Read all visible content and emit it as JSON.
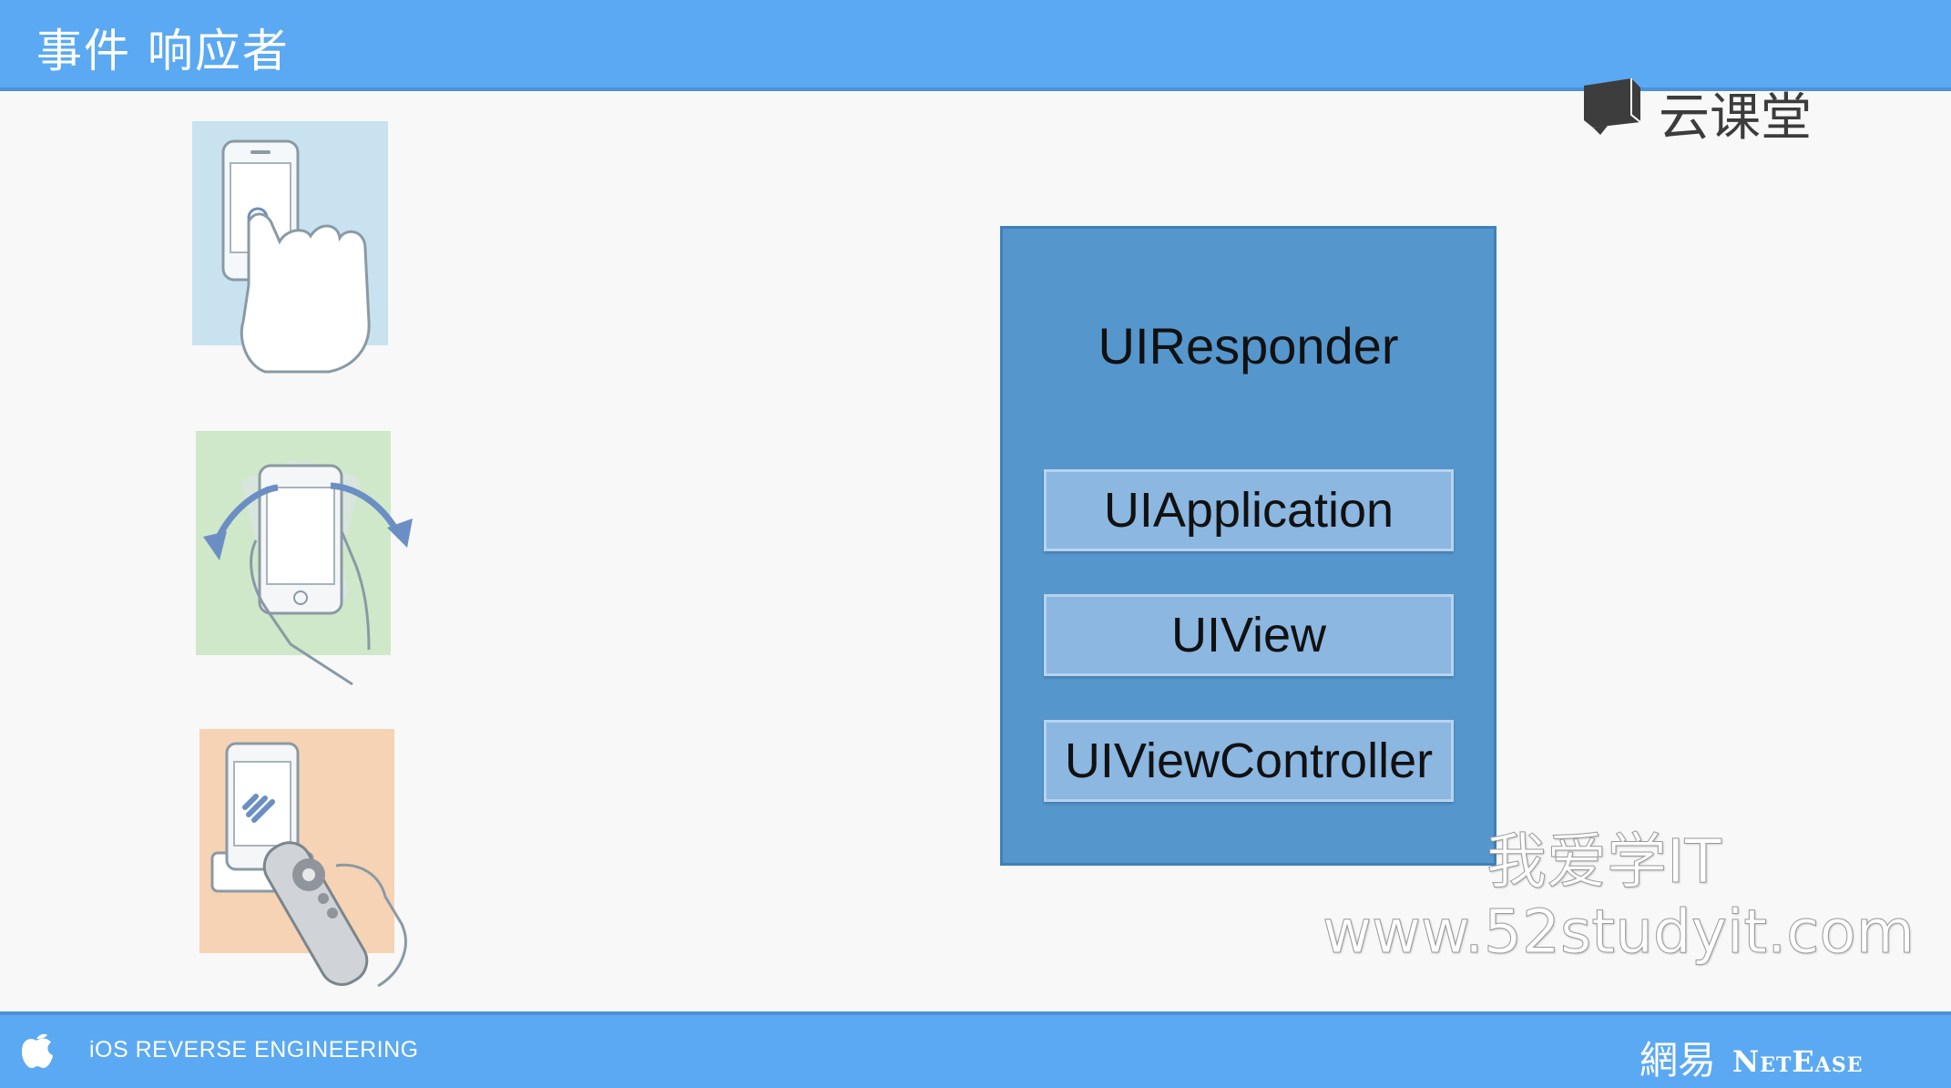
{
  "header": {
    "title": "事件 响应者"
  },
  "logo": {
    "text": "云课堂"
  },
  "illustrations": [
    {
      "name": "touch",
      "bg": "#c8e3ef"
    },
    {
      "name": "motion",
      "bg": "#cfe8c9"
    },
    {
      "name": "remote-control",
      "bg": "#f6d3b5"
    }
  ],
  "diagram": {
    "title": "UIResponder",
    "items": [
      "UIApplication",
      "UIView",
      "UIViewController"
    ]
  },
  "watermark": {
    "line1": "我爱学IT",
    "line2": "www.52studyit.com"
  },
  "footer": {
    "text": "iOS REVERSE ENGINEERING",
    "brand_cn": "網易",
    "brand_en": "NetEase"
  },
  "colors": {
    "bar": "#5ba9f2",
    "box": "#5596cc",
    "sub_box": "#8bb7e1"
  }
}
